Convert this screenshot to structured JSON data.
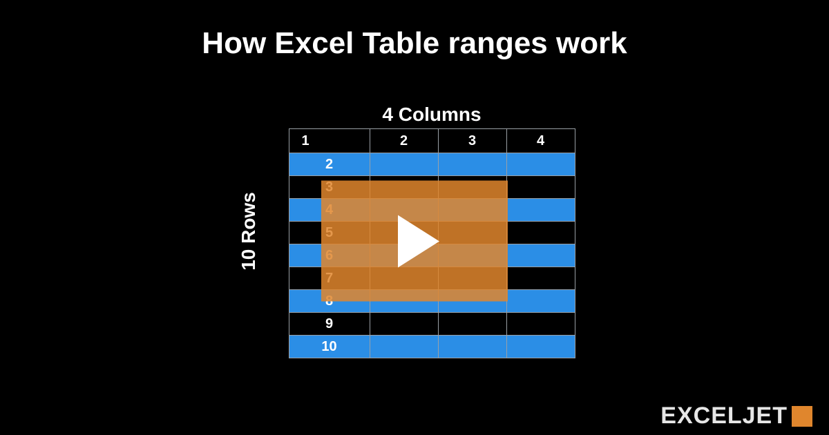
{
  "title": "How Excel Table ranges work",
  "columns_label": "4 Columns",
  "rows_label": "10 Rows",
  "header_row": [
    "1",
    "2",
    "3",
    "4"
  ],
  "body_rows": [
    {
      "num": "2",
      "style": "blue"
    },
    {
      "num": "3",
      "style": "black"
    },
    {
      "num": "4",
      "style": "blue"
    },
    {
      "num": "5",
      "style": "black"
    },
    {
      "num": "6",
      "style": "blue"
    },
    {
      "num": "7",
      "style": "black"
    },
    {
      "num": "8",
      "style": "blue"
    },
    {
      "num": "9",
      "style": "black"
    },
    {
      "num": "10",
      "style": "blue"
    }
  ],
  "logo_text": "EXCELJET",
  "play_button": "play"
}
